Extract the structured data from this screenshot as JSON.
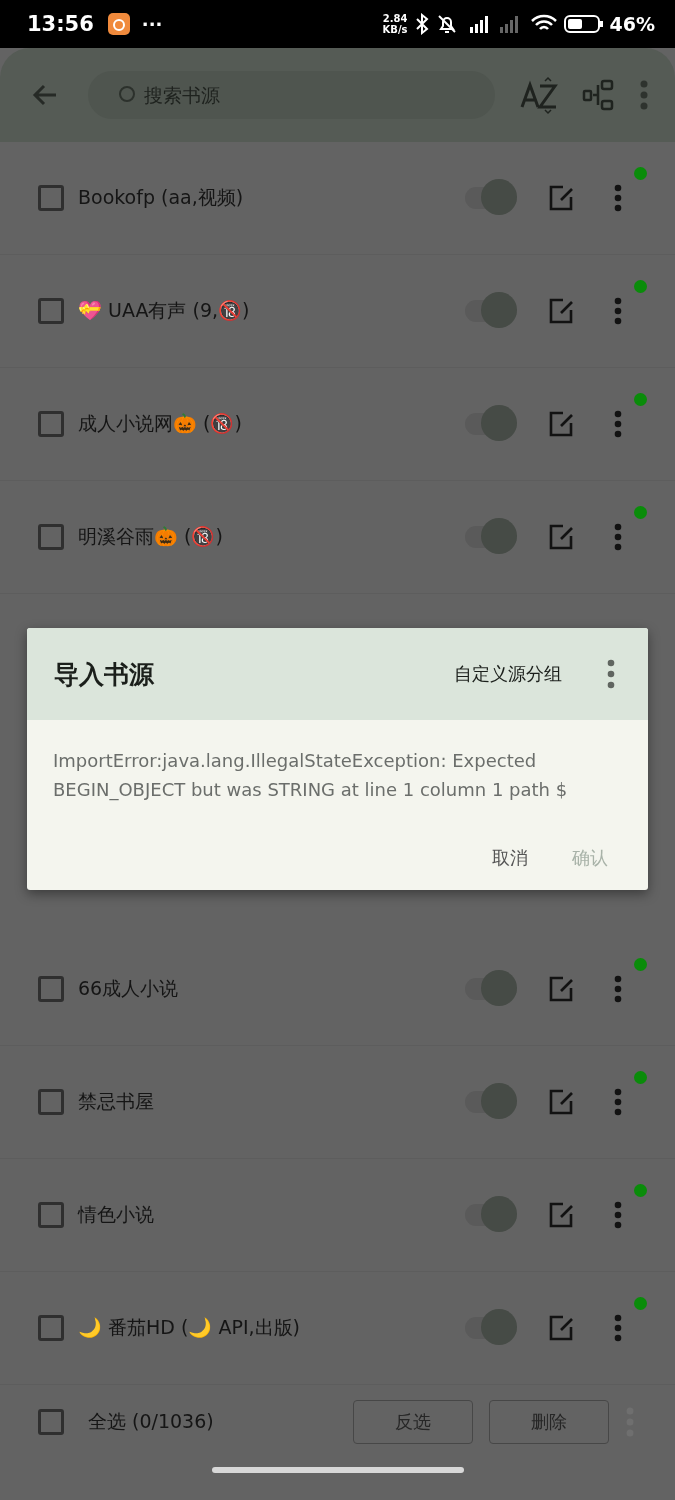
{
  "status_bar": {
    "time": "13:56",
    "more": "···",
    "speed_value": "2.84",
    "speed_unit": "KB/s",
    "battery": "46%"
  },
  "app_bar": {
    "search": {
      "placeholder": "搜索书源"
    }
  },
  "rows_above": [
    {
      "name": "Bookofp (aa,视频)",
      "checked": false,
      "enabled": true,
      "color": "#0a8c0a"
    },
    {
      "name": "💝 UAA有声 (9,🔞)",
      "checked": false,
      "enabled": true,
      "color": "#0a8c0a"
    },
    {
      "name": "成人小说网🎃 (🔞)",
      "checked": false,
      "enabled": true,
      "color": "#0a8c0a"
    },
    {
      "name": "明溪谷雨🎃 (🔞)",
      "checked": false,
      "enabled": true,
      "color": "#0a8c0a"
    }
  ],
  "rows_below": [
    {
      "name": "66成人小说",
      "checked": false,
      "enabled": true,
      "color": "#0a8c0a"
    },
    {
      "name": "禁忌书屋",
      "checked": false,
      "enabled": true,
      "color": "#0a8c0a"
    },
    {
      "name": "情色小说",
      "checked": false,
      "enabled": true,
      "color": "#0a8c0a"
    },
    {
      "name": "🌙 番茄HD (🌙 API,出版)",
      "checked": false,
      "enabled": true,
      "color": "#0a8c0a"
    }
  ],
  "bottom_bar": {
    "select_all": {
      "label": "全选 (0/1036)",
      "checked": false
    },
    "buttons": [
      "反选",
      "删除"
    ]
  },
  "dialog": {
    "title": "导入书源",
    "action": "自定义源分组",
    "message": "ImportError:java.lang.IllegalStateException: Expected BEGIN_OBJECT but was STRING at line 1 column 1 path $",
    "buttons": [
      {
        "label": "取消",
        "disabled": false
      },
      {
        "label": "确认",
        "disabled": true
      }
    ]
  }
}
